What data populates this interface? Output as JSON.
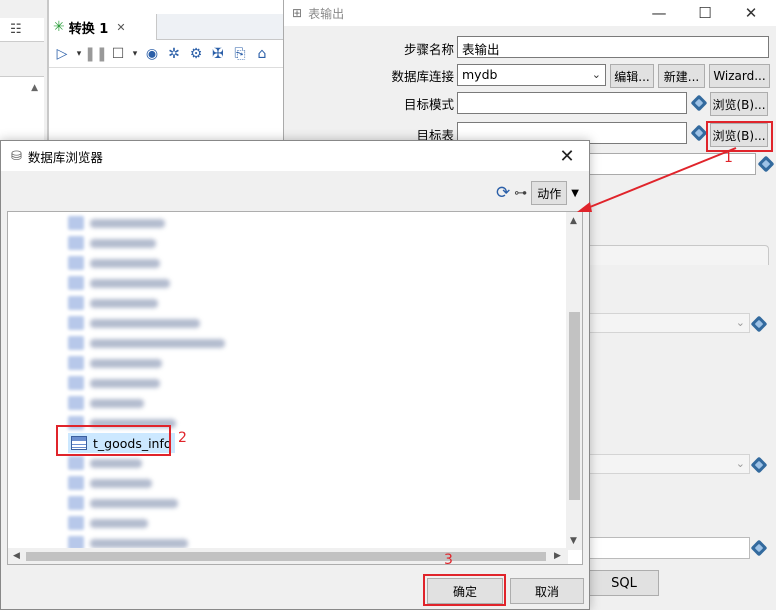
{
  "editor": {
    "tab_label": "转换 1",
    "tab_close": "✕"
  },
  "table_output": {
    "title": "表输出",
    "labels": {
      "step_name": "步骤名称",
      "db_connection": "数据库连接",
      "target_schema": "目标模式",
      "target_table": "目标表"
    },
    "values": {
      "step_name": "表输出",
      "db_connection": "mydb",
      "target_schema": "",
      "target_table": ""
    },
    "buttons": {
      "edit": "编辑...",
      "new": "新建...",
      "wizard": "Wizard...",
      "browse_schema": "浏览(B)...",
      "browse_table": "浏览(B)...",
      "sql": "SQL"
    }
  },
  "db_browser": {
    "title": "数据库浏览器",
    "action_label": "动作",
    "selected_table": "t_goods_info",
    "ok_label": "确定",
    "cancel_label": "取消"
  },
  "annotations": {
    "step1": "1",
    "step2": "2",
    "step3": "3"
  },
  "colors": {
    "annotation": "#e0242b",
    "selection": "#cce8ff"
  }
}
